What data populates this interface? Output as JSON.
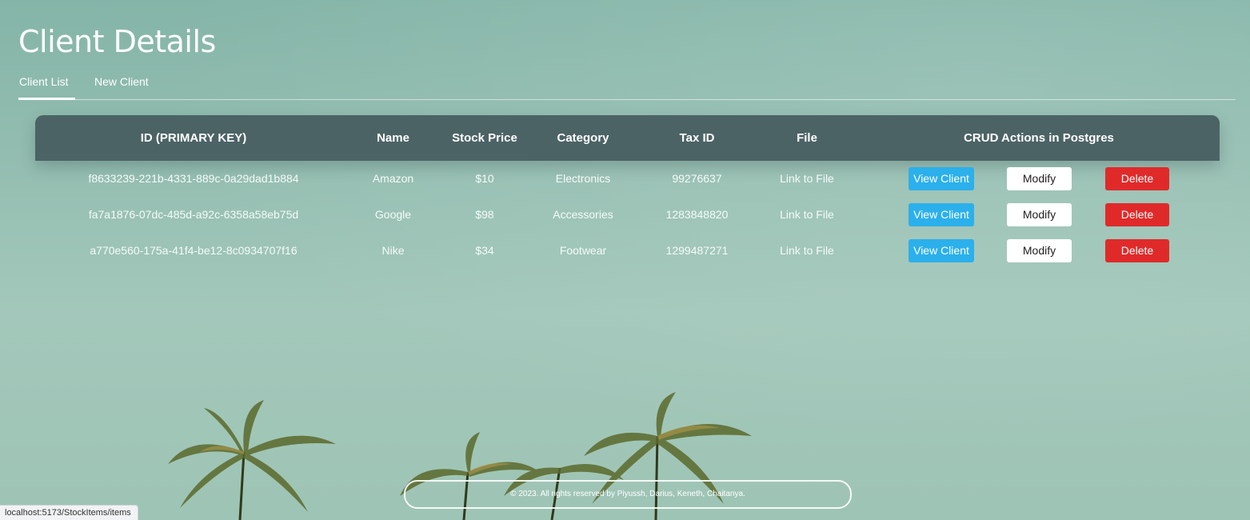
{
  "page": {
    "title": "Client Details"
  },
  "tabs": [
    {
      "label": "Client List",
      "active": true
    },
    {
      "label": "New Client",
      "active": false
    }
  ],
  "table": {
    "headers": [
      "ID (PRIMARY KEY)",
      "Name",
      "Stock Price",
      "Category",
      "Tax ID",
      "File",
      "CRUD Actions in Postgres"
    ],
    "rows": [
      {
        "id": "f8633239-221b-4331-889c-0a29dad1b884",
        "name": "Amazon",
        "price": "$10",
        "category": "Electronics",
        "tax_id": "99276637",
        "file": "Link to File"
      },
      {
        "id": "fa7a1876-07dc-485d-a92c-6358a58eb75d",
        "name": "Google",
        "price": "$98",
        "category": "Accessories",
        "tax_id": "1283848820",
        "file": "Link to File"
      },
      {
        "id": "a770e560-175a-41f4-be12-8c0934707f16",
        "name": "Nike",
        "price": "$34",
        "category": "Footwear",
        "tax_id": "1299487271",
        "file": "Link to File"
      }
    ],
    "actions": {
      "view": "View Client",
      "modify": "Modify",
      "delete": "Delete"
    }
  },
  "footer": {
    "text": "© 2023. All rights reserved by Piyussh, Darius, Keneth, Chaitanya."
  },
  "status_bar": {
    "url": "localhost:5173/StockItems/items"
  },
  "colors": {
    "header_bg": "#4c6366",
    "view_button": "#2bb0ec",
    "delete_button": "#e02a2a",
    "modify_button": "#ffffff"
  }
}
